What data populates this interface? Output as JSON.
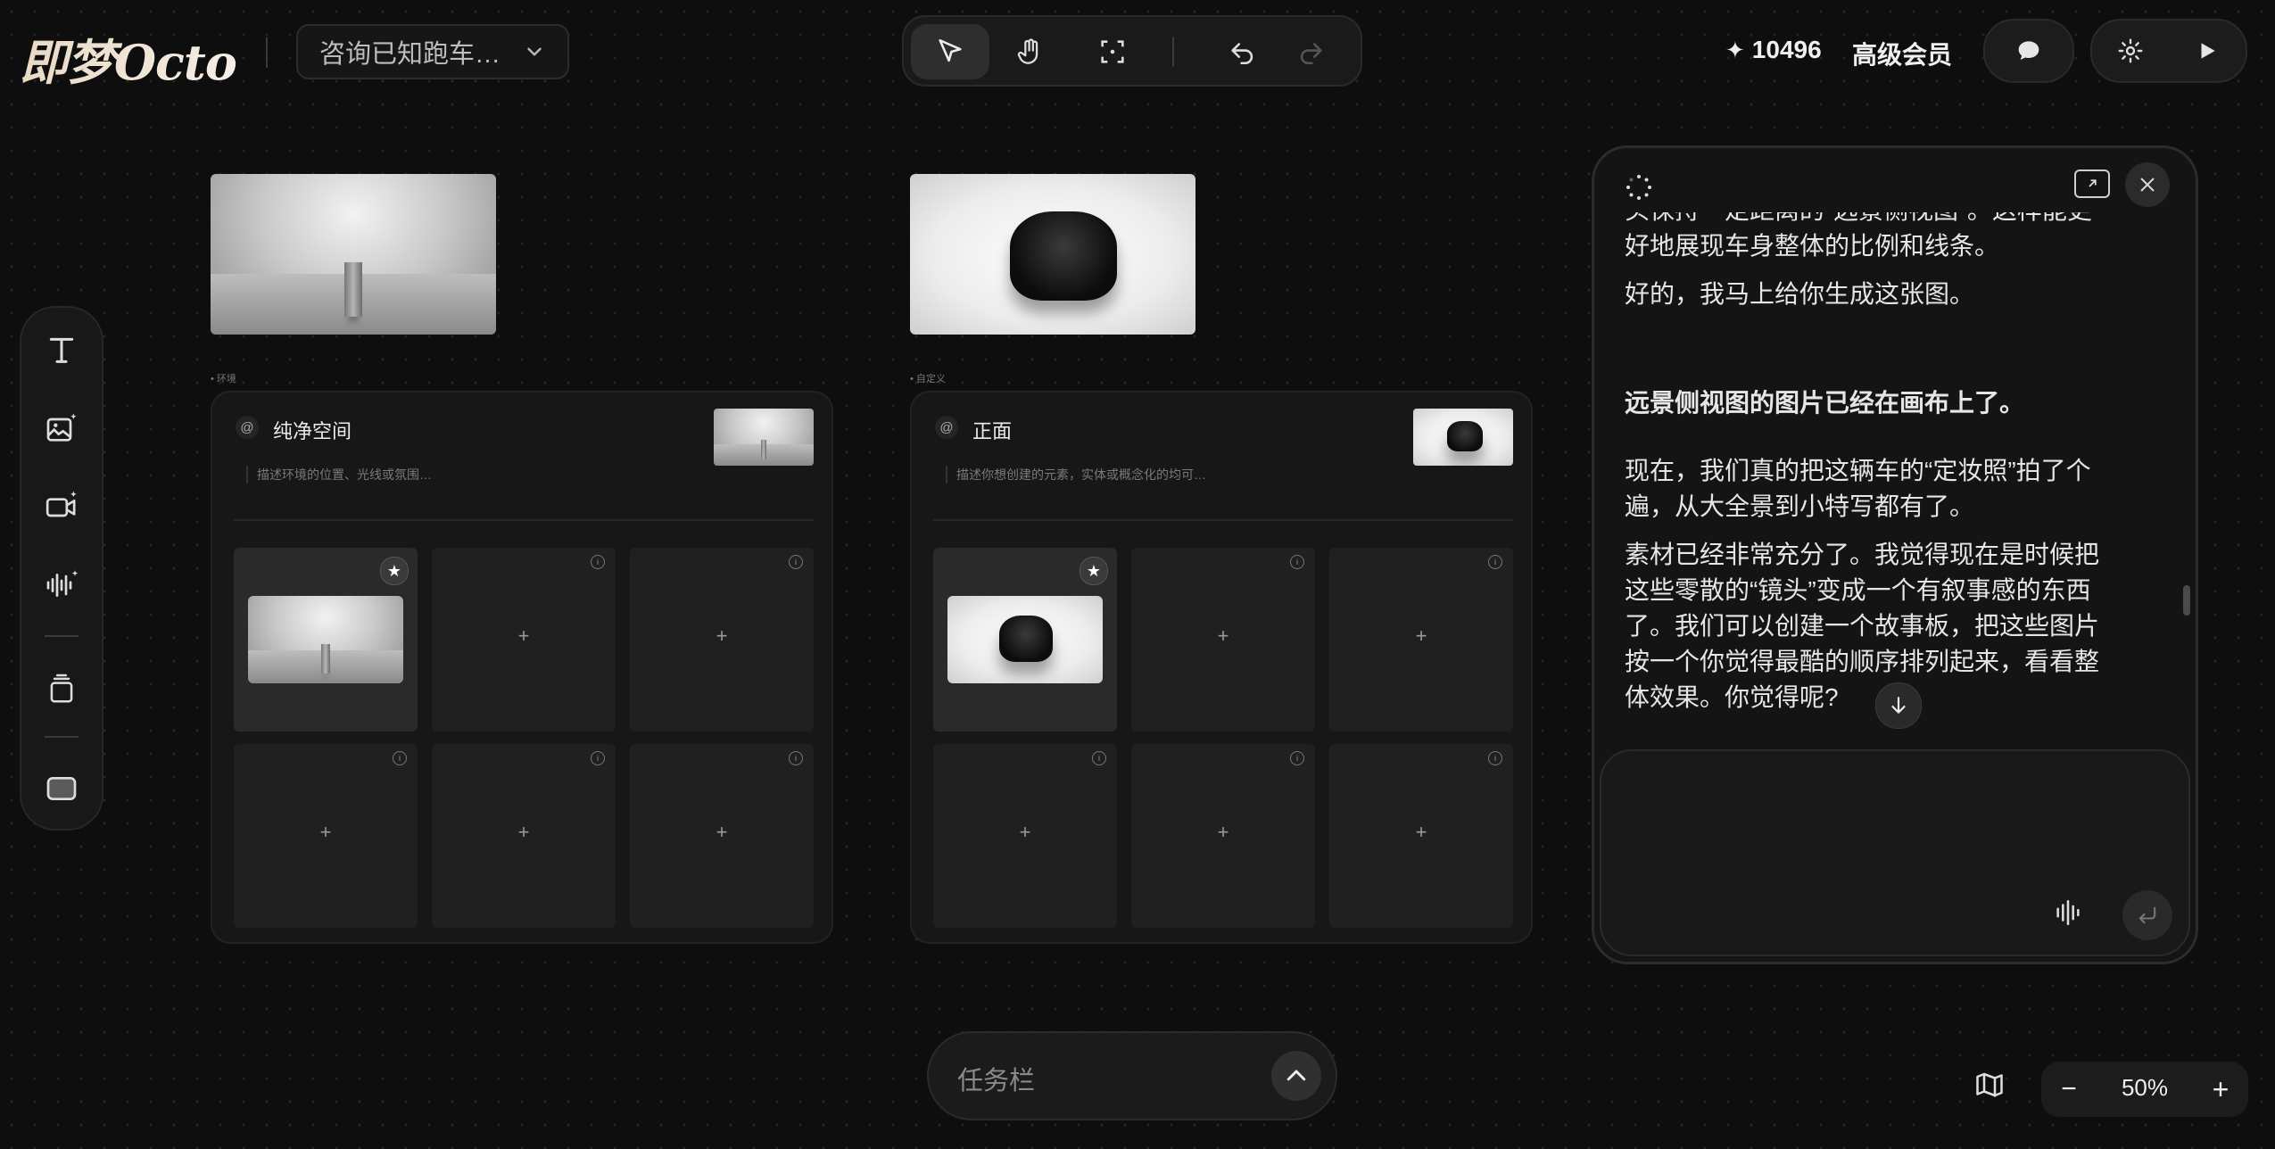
{
  "header": {
    "logo_text": "即梦Octo",
    "project_name": "咨询已知跑车…",
    "credits": "10496",
    "membership": "高级会员"
  },
  "toolbar": {
    "tools": [
      "select-cursor-icon",
      "hand-pan-icon",
      "focus-frame-icon",
      "undo-icon",
      "redo-icon"
    ]
  },
  "left_tools": [
    "text-tool-icon",
    "image-generate-icon",
    "video-generate-icon",
    "audio-generate-icon",
    "stack-icon",
    "frame-icon"
  ],
  "canvas": {
    "panel_env": {
      "tag": "环境",
      "title": "纯净空间",
      "description": "描述环境的位置、光线或氛围…",
      "grid_plus": "+"
    },
    "panel_custom": {
      "tag": "自定义",
      "title": "正面",
      "description": "描述你想创建的元素，实体或概念化的均可…",
      "grid_plus": "+"
    }
  },
  "chat": {
    "partial_top": "头保持一定距离的\"远景侧视图\"。这样能更",
    "msg1": "好地展现车身整体的比例和线条。",
    "msg2": "好的，我马上给你生成这张图。",
    "msg3_bold": "远景侧视图的图片已经在画布上了。",
    "msg4_lines": [
      "现在，我们真的把这辆车的“定妆照”拍了个",
      "遍，从大全景到小特写都有了。"
    ],
    "msg5_lines": [
      "素材已经非常充分了。我觉得现在是时候把",
      "这些零散的“镜头”变成一个有叙事感的东西",
      "了。我们可以创建一个故事板，把这些图片",
      "按一个你觉得最酷的顺序排列起来，看看整",
      "体效果。你觉得呢?"
    ]
  },
  "taskbar": {
    "label": "任务栏"
  },
  "zoom": {
    "minus": "−",
    "value": "50%",
    "plus": "+"
  }
}
